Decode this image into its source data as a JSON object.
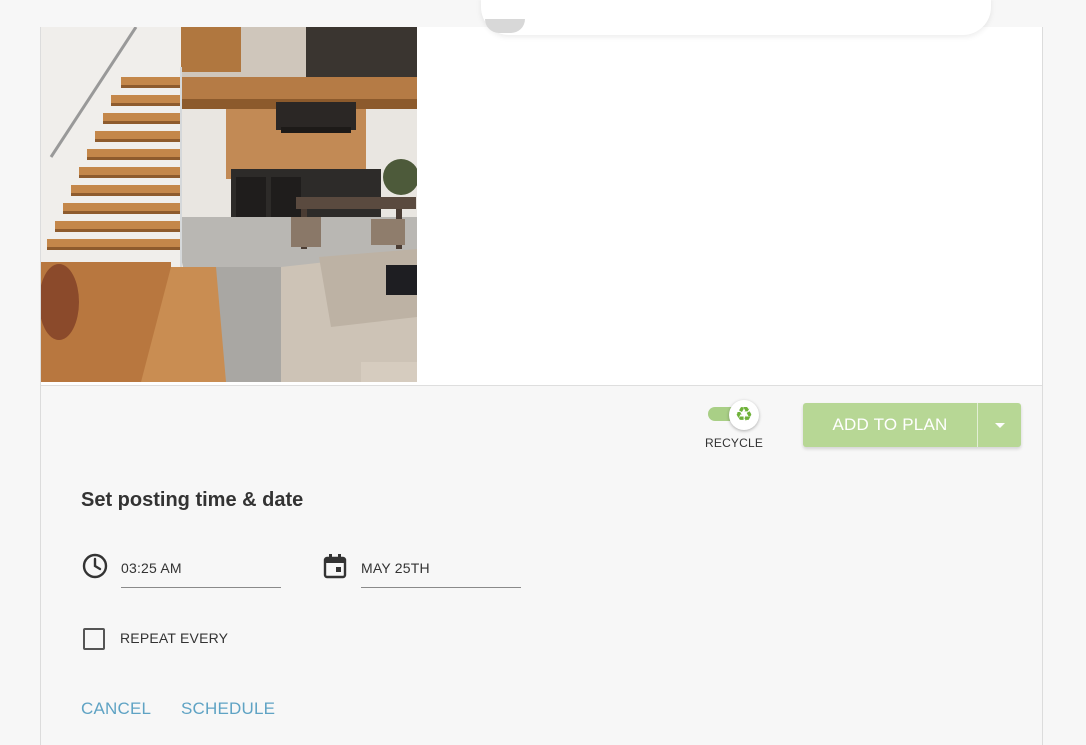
{
  "action_bar": {
    "recycle_label": "RECYCLE",
    "recycle_icon": "recycle-icon",
    "recycle_enabled": true,
    "add_to_plan_label": "ADD TO PLAN",
    "accent_color": "#b7d795"
  },
  "schedule_form": {
    "title": "Set posting time & date",
    "time_value": "03:25 AM",
    "date_value": "MAY 25TH",
    "repeat_label": "REPEAT EVERY",
    "repeat_checked": false,
    "cancel_label": "CANCEL",
    "schedule_label": "SCHEDULE",
    "link_color": "#5fa3c4"
  }
}
